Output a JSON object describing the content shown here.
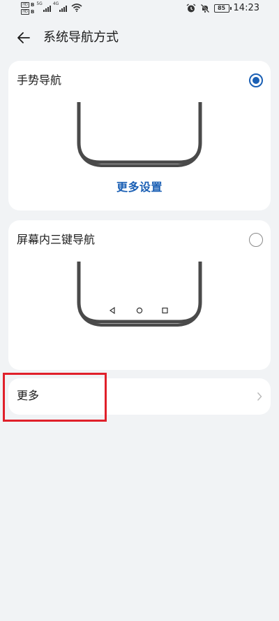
{
  "status_bar": {
    "sim1": "HD",
    "sim2": "HD",
    "sim_badge": "B",
    "net_tag_1": "5G",
    "net_tag_2": "4G",
    "battery": "85",
    "time": "14:23"
  },
  "header": {
    "title": "系统导航方式"
  },
  "options": {
    "gesture": {
      "label": "手势导航",
      "selected": true,
      "more_settings": "更多设置"
    },
    "three_key": {
      "label": "屏幕内三键导航",
      "selected": false
    }
  },
  "more": {
    "label": "更多"
  },
  "colors": {
    "accent": "#1a5fb4",
    "highlight": "#e0202a",
    "background": "#f1f3f5"
  }
}
